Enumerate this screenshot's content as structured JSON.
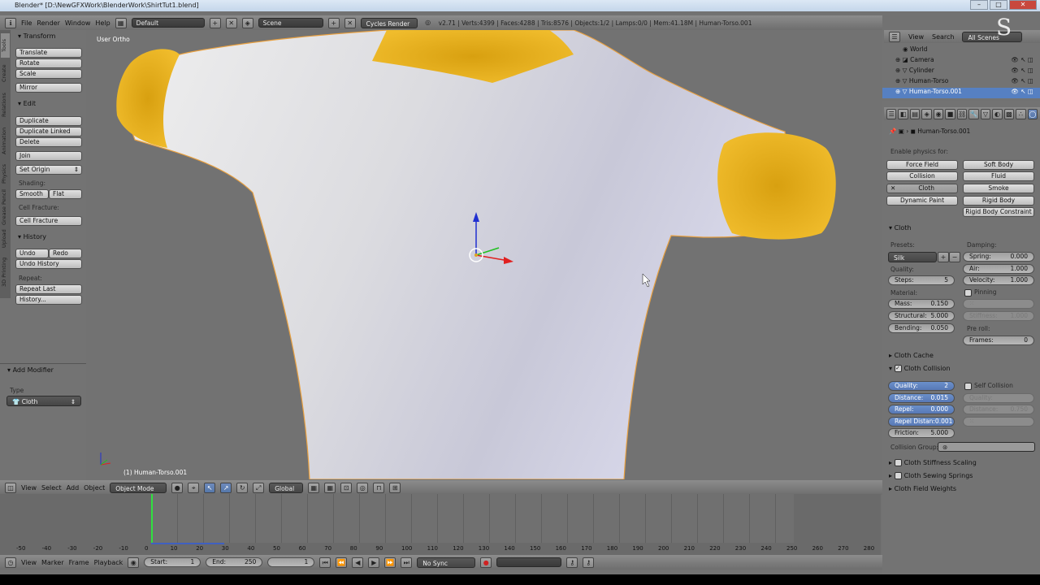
{
  "title": "Blender* [D:\\NewGFXWork\\BlenderWork\\ShirtTut1.blend]",
  "info_header": {
    "menus": [
      "File",
      "Render",
      "Window",
      "Help"
    ],
    "layout": "Default",
    "scene": "Scene",
    "engine": "Cycles Render",
    "stats": "v2.71 | Verts:4399 | Faces:4288 | Tris:8576 | Objects:1/2 | Lamps:0/0 | Mem:41.18M | Human-Torso.001"
  },
  "toolshelf": {
    "tabs": [
      "Tools",
      "Create",
      "Relations",
      "Animation",
      "Physics",
      "Grease Pencil",
      "Upload",
      "3D Printing"
    ],
    "transform": {
      "title": "Transform",
      "buttons": [
        "Translate",
        "Rotate",
        "Scale",
        "Mirror"
      ]
    },
    "edit": {
      "title": "Edit",
      "buttons": [
        "Duplicate",
        "Duplicate Linked",
        "Delete",
        "Join"
      ],
      "set_origin": "Set Origin",
      "shading_label": "Shading:",
      "smooth": "Smooth",
      "flat": "Flat",
      "cell_label": "Cell Fracture:",
      "cell_button": "Cell Fracture"
    },
    "history": {
      "title": "History",
      "undo": "Undo",
      "redo": "Redo",
      "undo_history": "Undo History",
      "repeat_label": "Repeat:",
      "repeat_last": "Repeat Last",
      "history": "History..."
    },
    "operator": {
      "title": "Add Modifier",
      "type_label": "Type",
      "type_value": "Cloth"
    }
  },
  "viewport": {
    "view_name": "User Ortho",
    "object_label": "(1) Human-Torso.001"
  },
  "view3d_header": {
    "menus": [
      "View",
      "Select",
      "Add",
      "Object"
    ],
    "mode": "Object Mode",
    "orientation": "Global"
  },
  "outliner": {
    "menus": [
      "View",
      "Search"
    ],
    "filter": "All Scenes",
    "items": [
      {
        "name": "World"
      },
      {
        "name": "Camera"
      },
      {
        "name": "Cylinder"
      },
      {
        "name": "Human-Torso"
      },
      {
        "name": "Human-Torso.001"
      }
    ]
  },
  "properties": {
    "object_path": "Human-Torso.001",
    "enable_label": "Enable physics for:",
    "physics_buttons": [
      "Force Field",
      "Soft Body",
      "Collision",
      "Fluid",
      "Cloth",
      "Smoke",
      "Dynamic Paint",
      "Rigid Body",
      "",
      "Rigid Body Constraint"
    ],
    "cloth": {
      "title": "Cloth",
      "presets_label": "Presets:",
      "preset": "Silk",
      "quality_label": "Quality:",
      "steps_label": "Steps:",
      "steps": "5",
      "material_label": "Material:",
      "mass_label": "Mass:",
      "mass": "0.150",
      "structural_label": "Structural:",
      "structural": "5.000",
      "bending_label": "Bending:",
      "bending": "0.050",
      "damping_label": "Damping:",
      "spring_label": "Spring:",
      "spring": "0.000",
      "air_label": "Air:",
      "air": "1.000",
      "velocity_label": "Velocity:",
      "velocity": "1.000",
      "pinning_label": "Pinning",
      "stiffness_label": "Stiffness:",
      "stiffness": "1.000",
      "preroll_label": "Pre roll:",
      "frames_label": "Frames:",
      "frames": "0"
    },
    "cache_title": "Cloth Cache",
    "collision": {
      "title": "Cloth Collision",
      "quality_label": "Quality:",
      "quality": "2",
      "distance_label": "Distance:",
      "distance": "0.015",
      "repel_label": "Repel:",
      "repel": "0.000",
      "repel_dist_label": "Repel Distan:",
      "repel_dist": "0.001",
      "friction_label": "Friction:",
      "friction": "5.000",
      "self_label": "Self Collision",
      "self_quality_label": "Quality:",
      "self_quality": "",
      "self_distance_label": "Distance:",
      "self_distance": "0.750",
      "group_label": "Collision Group:"
    },
    "closed_panels": [
      "Cloth Stiffness Scaling",
      "Cloth Sewing Springs",
      "Cloth Field Weights"
    ]
  },
  "timeline": {
    "ticks": [
      "-50",
      "-40",
      "-30",
      "-20",
      "-10",
      "0",
      "10",
      "20",
      "30",
      "40",
      "50",
      "60",
      "70",
      "80",
      "90",
      "100",
      "110",
      "120",
      "130",
      "140",
      "150",
      "160",
      "170",
      "180",
      "190",
      "200",
      "210",
      "220",
      "230",
      "240",
      "250",
      "260",
      "270",
      "280"
    ],
    "current_frame_fraction": 0.5,
    "menus": [
      "View",
      "Marker",
      "Frame",
      "Playback"
    ],
    "start_label": "Start:",
    "start": "1",
    "end_label": "End:",
    "end": "250",
    "current": "1",
    "sync": "No Sync"
  },
  "colors": {
    "shirt": "#e8e8ee",
    "yellow": "#e8b420",
    "selection": "#5680c2",
    "background": "#727272"
  }
}
